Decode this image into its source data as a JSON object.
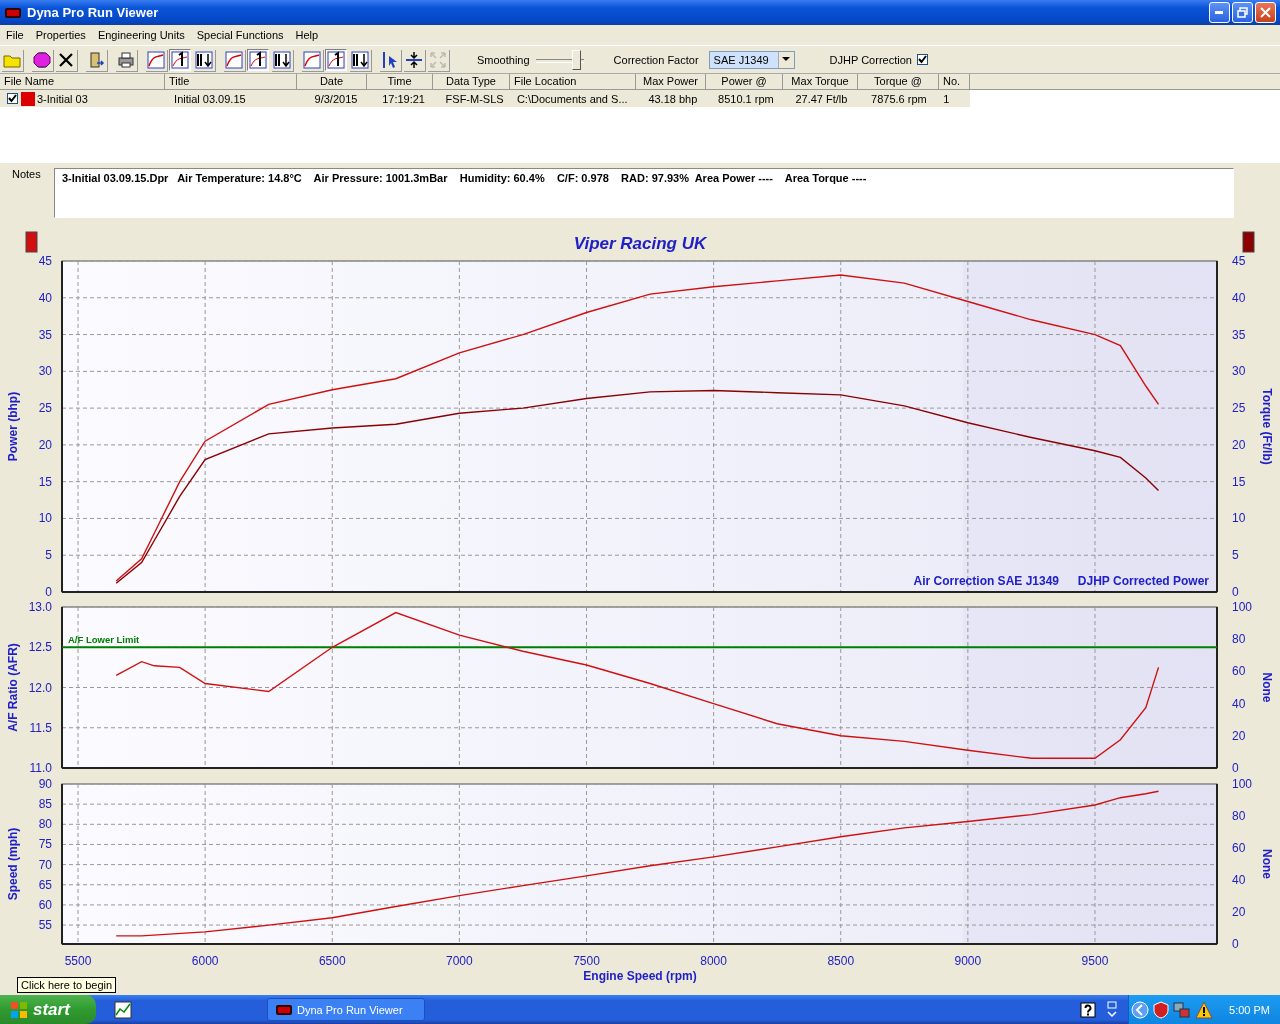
{
  "window": {
    "title": "Dyna Pro Run Viewer"
  },
  "menu": [
    "File",
    "Properties",
    "Engineering Units",
    "Special Functions",
    "Help"
  ],
  "toolbar": [
    {
      "kind": "open",
      "pressed": false,
      "disabled": false
    },
    {
      "kind": "info",
      "pressed": false,
      "disabled": false
    },
    {
      "kind": "delete",
      "pressed": false,
      "disabled": false
    },
    {
      "kind": "exit",
      "pressed": false,
      "disabled": false
    },
    {
      "kind": "print",
      "pressed": false,
      "disabled": false
    },
    {
      "kind": "curve",
      "pressed": false,
      "disabled": false
    },
    {
      "kind": "numbered",
      "pressed": true,
      "disabled": false
    },
    {
      "kind": "sorted",
      "pressed": false,
      "disabled": false
    },
    {
      "kind": "curve",
      "pressed": false,
      "disabled": false
    },
    {
      "kind": "numbered",
      "pressed": true,
      "disabled": false
    },
    {
      "kind": "sorted",
      "pressed": false,
      "disabled": false
    },
    {
      "kind": "curve",
      "pressed": false,
      "disabled": false
    },
    {
      "kind": "numbered",
      "pressed": true,
      "disabled": false
    },
    {
      "kind": "sorted",
      "pressed": false,
      "disabled": false
    },
    {
      "kind": "cursor",
      "pressed": false,
      "disabled": false
    },
    {
      "kind": "fit",
      "pressed": false,
      "disabled": false
    },
    {
      "kind": "expand",
      "pressed": false,
      "disabled": true
    }
  ],
  "smoothing": {
    "label": "Smoothing",
    "level": 0.95
  },
  "correction_factor": {
    "label": "Correction Factor",
    "value": "SAE J1349"
  },
  "djhp_correction": {
    "label": "DJHP Correction",
    "checked": true
  },
  "table": {
    "columns": [
      "File Name",
      "Title",
      "Date",
      "Time",
      "Data Type",
      "File Location",
      "Max Power",
      "Power @",
      "Max Torque",
      "Torque @",
      "No."
    ],
    "rows": [
      {
        "checked": true,
        "color": "#dd0000",
        "cells": [
          "3-Initial 03",
          "Initial 03.09.15",
          "9/3/2015",
          "17:19:21",
          "FSF-M-SLS",
          "C:\\Documents and S...",
          "43.18 bhp",
          "8510.1 rpm",
          "27.47 Ft/lb",
          "7875.6 rpm",
          "1"
        ]
      }
    ]
  },
  "notes": {
    "label": "Notes",
    "text": "3-Initial 03.09.15.Dpr   Air Temperature: 14.8°C    Air Pressure: 1001.3mBar    Humidity: 60.4%    C/F: 0.978    RAD: 97.93%  Area Power ----    Area Torque ----"
  },
  "graph": {
    "panels": [
      {
        "chart_data": {
          "type": "line",
          "title": "Viper Racing UK",
          "ylabel": "Power (bhp)",
          "x": [
            5650,
            5750,
            5800,
            5900,
            6000,
            6250,
            6500,
            6750,
            7000,
            7250,
            7500,
            7750,
            8000,
            8250,
            8500,
            8750,
            9000,
            9250,
            9500,
            9600,
            9700,
            9750
          ],
          "xlim": [
            5437,
            9980
          ],
          "ylim": [
            0,
            45
          ],
          "grid": true,
          "yticks": [
            0,
            5,
            10,
            15,
            20,
            25,
            30,
            35,
            40,
            45
          ],
          "series": [
            {
              "color": "#d01010",
              "values": [
                1.5,
                4.5,
                8,
                15,
                20.5,
                25.5,
                27.5,
                29,
                32.5,
                35,
                38,
                40.5,
                41.5,
                42.3,
                43.1,
                42,
                39.5,
                37,
                35,
                33.5,
                28,
                25.5
              ]
            },
            {
              "color": "#8b0000",
              "values": [
                1.2,
                4,
                7,
                13,
                18,
                21.5,
                22.3,
                22.8,
                24.3,
                25,
                26.3,
                27.2,
                27.4,
                27.1,
                26.8,
                25.3,
                23,
                21,
                19.2,
                18.3,
                15.5,
                13.8
              ]
            }
          ]
        },
        "y2label": "Torque (Ft/lb)",
        "y2ticks": [
          "45",
          "40",
          "35",
          "30",
          "25",
          "20",
          "15",
          "10",
          "5",
          "0"
        ],
        "legend": [
          "Air Correction SAE J1349",
          "DJHP Corrected Power"
        ]
      },
      {
        "chart_data": {
          "type": "line",
          "ylabel": "A/F Ratio (AFR)",
          "x": [
            5650,
            5750,
            5800,
            5900,
            6000,
            6250,
            6500,
            6750,
            7000,
            7250,
            7500,
            7750,
            8000,
            8250,
            8500,
            8750,
            9000,
            9250,
            9500,
            9600,
            9700,
            9750
          ],
          "xlim": [
            5437,
            9980
          ],
          "ylim": [
            11,
            13
          ],
          "grid": true,
          "yticks": [
            {
              "value": 11,
              "label": "11.0"
            },
            {
              "value": 11.5,
              "label": "11.5"
            },
            {
              "value": 12,
              "label": "12.0"
            },
            {
              "value": 12.5,
              "label": "12.5"
            },
            {
              "value": 13,
              "label": "13.0"
            }
          ],
          "series": [
            {
              "color": "#d01010",
              "values": [
                12.15,
                12.32,
                12.27,
                12.25,
                12.05,
                11.95,
                12.5,
                12.93,
                12.65,
                12.45,
                12.28,
                12.05,
                11.8,
                11.55,
                11.4,
                11.33,
                11.22,
                11.12,
                11.12,
                11.35,
                11.75,
                12.25
              ]
            }
          ],
          "ref_lines": [
            {
              "axis": "y",
              "value": 12.5,
              "label": "A/F Lower Limit",
              "color": "#008000"
            }
          ]
        },
        "y2label": "None",
        "y2ticks": [
          "100",
          "80",
          "60",
          "40",
          "20",
          "0"
        ]
      },
      {
        "chart_data": {
          "type": "line",
          "xlabel": "Engine Speed (rpm)",
          "ylabel": "Speed (mph)",
          "x": [
            5650,
            5750,
            6000,
            6250,
            6500,
            6750,
            7000,
            7250,
            7500,
            7750,
            8000,
            8250,
            8500,
            8750,
            9000,
            9250,
            9500,
            9600,
            9700,
            9750
          ],
          "xlim": [
            5437,
            9980
          ],
          "ylim": [
            50.3,
            90
          ],
          "grid": true,
          "xticks": [
            5500,
            6000,
            6500,
            7000,
            7500,
            8000,
            8500,
            9000,
            9500
          ],
          "yticks": [
            55,
            60,
            65,
            70,
            75,
            80,
            85,
            90
          ],
          "series": [
            {
              "color": "#d01010",
              "values": [
                52.3,
                52.3,
                53.3,
                55,
                56.8,
                59.6,
                62.3,
                64.8,
                67.2,
                69.7,
                71.9,
                74.4,
                76.9,
                79.1,
                80.7,
                82.4,
                84.8,
                86.6,
                87.6,
                88.2
              ]
            }
          ]
        },
        "y2label": "None",
        "y2ticks": [
          "100",
          "80",
          "60",
          "40",
          "20",
          "0"
        ]
      }
    ]
  },
  "tooltip": "Click here to begin",
  "taskbar": {
    "start": "start",
    "tasks": [
      {
        "label": "Dyna Pro Run Viewer",
        "selected": false
      }
    ],
    "clock": "5:00 PM"
  }
}
